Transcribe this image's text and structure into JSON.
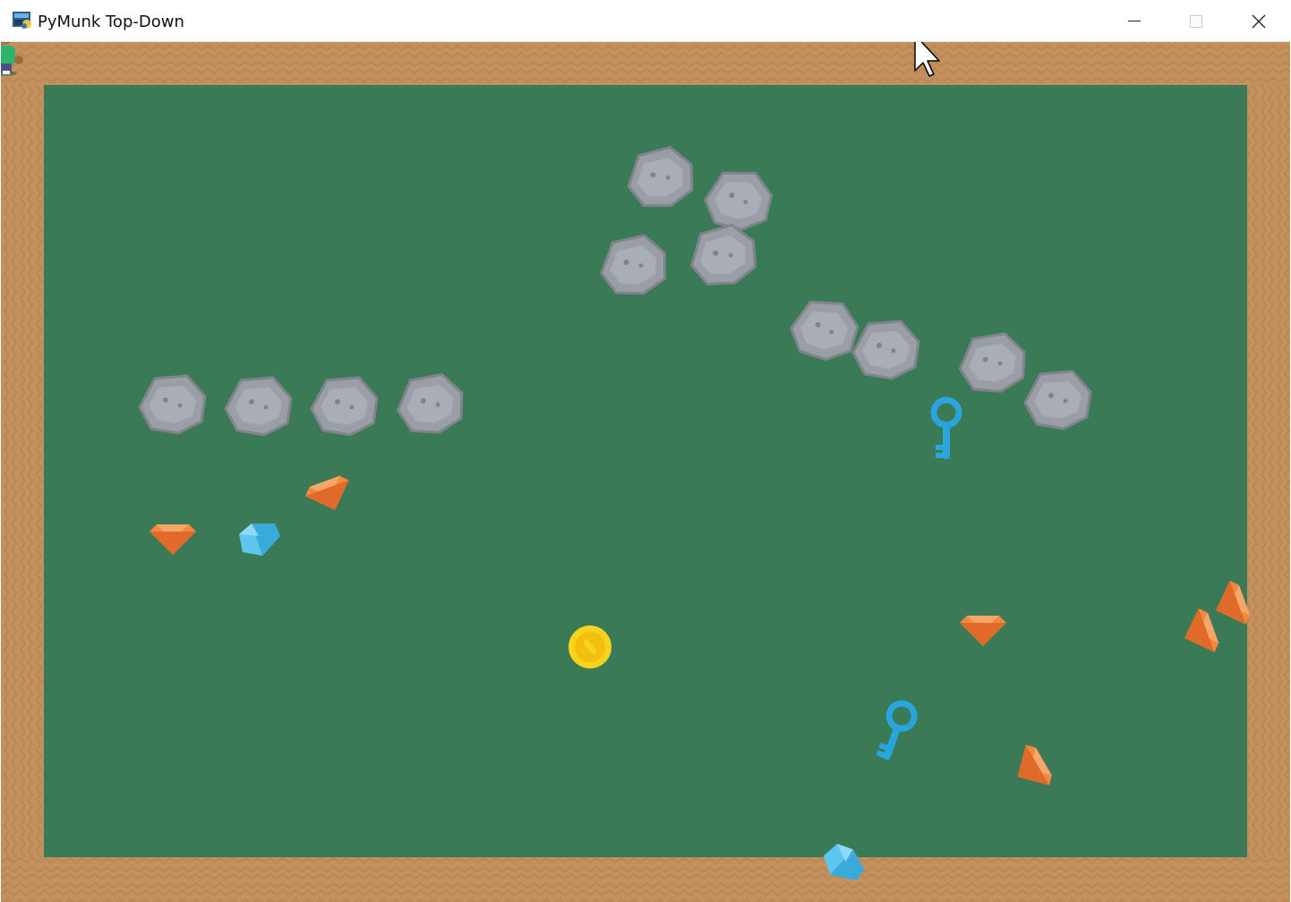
{
  "window": {
    "title": "PyMunk Top-Down",
    "controls": [
      "minimize",
      "maximize",
      "close"
    ]
  },
  "colors": {
    "ground": "#3b7a57",
    "wall": "#c4905e",
    "wall_pattern": "#b07d4e",
    "rock": "#9a9fa6",
    "rock_outline": "#80858c",
    "orange_gem": "#f08a3e",
    "blue_gem": "#5cc6ee",
    "coin": "#f7d31d",
    "key": "#2aa4df"
  },
  "game": {
    "entities": [
      {
        "kind": "rock"
      },
      {
        "kind": "rock"
      },
      {
        "kind": "rock"
      },
      {
        "kind": "rock"
      },
      {
        "kind": "rock"
      },
      {
        "kind": "rock"
      },
      {
        "kind": "rock"
      },
      {
        "kind": "rock"
      },
      {
        "kind": "rock"
      },
      {
        "kind": "rock"
      },
      {
        "kind": "rock"
      },
      {
        "kind": "rock"
      },
      {
        "kind": "orange-gem"
      },
      {
        "kind": "orange-gem"
      },
      {
        "kind": "orange-gem"
      },
      {
        "kind": "orange-gem"
      },
      {
        "kind": "orange-gem"
      },
      {
        "kind": "orange-gem"
      },
      {
        "kind": "blue-gem"
      },
      {
        "kind": "blue-gem"
      },
      {
        "kind": "coin"
      },
      {
        "kind": "key"
      },
      {
        "kind": "key"
      },
      {
        "kind": "player"
      }
    ]
  }
}
